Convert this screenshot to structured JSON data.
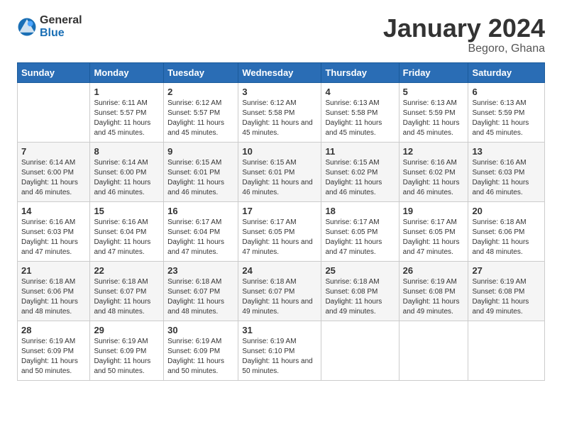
{
  "header": {
    "logo_general": "General",
    "logo_blue": "Blue",
    "title": "January 2024",
    "subtitle": "Begoro, Ghana"
  },
  "calendar": {
    "columns": [
      "Sunday",
      "Monday",
      "Tuesday",
      "Wednesday",
      "Thursday",
      "Friday",
      "Saturday"
    ],
    "weeks": [
      [
        {
          "day": "",
          "sunrise": "",
          "sunset": "",
          "daylight": ""
        },
        {
          "day": "1",
          "sunrise": "6:11 AM",
          "sunset": "5:57 PM",
          "daylight": "11 hours and 45 minutes."
        },
        {
          "day": "2",
          "sunrise": "6:12 AM",
          "sunset": "5:57 PM",
          "daylight": "11 hours and 45 minutes."
        },
        {
          "day": "3",
          "sunrise": "6:12 AM",
          "sunset": "5:58 PM",
          "daylight": "11 hours and 45 minutes."
        },
        {
          "day": "4",
          "sunrise": "6:13 AM",
          "sunset": "5:58 PM",
          "daylight": "11 hours and 45 minutes."
        },
        {
          "day": "5",
          "sunrise": "6:13 AM",
          "sunset": "5:59 PM",
          "daylight": "11 hours and 45 minutes."
        },
        {
          "day": "6",
          "sunrise": "6:13 AM",
          "sunset": "5:59 PM",
          "daylight": "11 hours and 45 minutes."
        }
      ],
      [
        {
          "day": "7",
          "sunrise": "6:14 AM",
          "sunset": "6:00 PM",
          "daylight": "11 hours and 46 minutes."
        },
        {
          "day": "8",
          "sunrise": "6:14 AM",
          "sunset": "6:00 PM",
          "daylight": "11 hours and 46 minutes."
        },
        {
          "day": "9",
          "sunrise": "6:15 AM",
          "sunset": "6:01 PM",
          "daylight": "11 hours and 46 minutes."
        },
        {
          "day": "10",
          "sunrise": "6:15 AM",
          "sunset": "6:01 PM",
          "daylight": "11 hours and 46 minutes."
        },
        {
          "day": "11",
          "sunrise": "6:15 AM",
          "sunset": "6:02 PM",
          "daylight": "11 hours and 46 minutes."
        },
        {
          "day": "12",
          "sunrise": "6:16 AM",
          "sunset": "6:02 PM",
          "daylight": "11 hours and 46 minutes."
        },
        {
          "day": "13",
          "sunrise": "6:16 AM",
          "sunset": "6:03 PM",
          "daylight": "11 hours and 46 minutes."
        }
      ],
      [
        {
          "day": "14",
          "sunrise": "6:16 AM",
          "sunset": "6:03 PM",
          "daylight": "11 hours and 47 minutes."
        },
        {
          "day": "15",
          "sunrise": "6:16 AM",
          "sunset": "6:04 PM",
          "daylight": "11 hours and 47 minutes."
        },
        {
          "day": "16",
          "sunrise": "6:17 AM",
          "sunset": "6:04 PM",
          "daylight": "11 hours and 47 minutes."
        },
        {
          "day": "17",
          "sunrise": "6:17 AM",
          "sunset": "6:05 PM",
          "daylight": "11 hours and 47 minutes."
        },
        {
          "day": "18",
          "sunrise": "6:17 AM",
          "sunset": "6:05 PM",
          "daylight": "11 hours and 47 minutes."
        },
        {
          "day": "19",
          "sunrise": "6:17 AM",
          "sunset": "6:05 PM",
          "daylight": "11 hours and 47 minutes."
        },
        {
          "day": "20",
          "sunrise": "6:18 AM",
          "sunset": "6:06 PM",
          "daylight": "11 hours and 48 minutes."
        }
      ],
      [
        {
          "day": "21",
          "sunrise": "6:18 AM",
          "sunset": "6:06 PM",
          "daylight": "11 hours and 48 minutes."
        },
        {
          "day": "22",
          "sunrise": "6:18 AM",
          "sunset": "6:07 PM",
          "daylight": "11 hours and 48 minutes."
        },
        {
          "day": "23",
          "sunrise": "6:18 AM",
          "sunset": "6:07 PM",
          "daylight": "11 hours and 48 minutes."
        },
        {
          "day": "24",
          "sunrise": "6:18 AM",
          "sunset": "6:07 PM",
          "daylight": "11 hours and 49 minutes."
        },
        {
          "day": "25",
          "sunrise": "6:18 AM",
          "sunset": "6:08 PM",
          "daylight": "11 hours and 49 minutes."
        },
        {
          "day": "26",
          "sunrise": "6:19 AM",
          "sunset": "6:08 PM",
          "daylight": "11 hours and 49 minutes."
        },
        {
          "day": "27",
          "sunrise": "6:19 AM",
          "sunset": "6:08 PM",
          "daylight": "11 hours and 49 minutes."
        }
      ],
      [
        {
          "day": "28",
          "sunrise": "6:19 AM",
          "sunset": "6:09 PM",
          "daylight": "11 hours and 50 minutes."
        },
        {
          "day": "29",
          "sunrise": "6:19 AM",
          "sunset": "6:09 PM",
          "daylight": "11 hours and 50 minutes."
        },
        {
          "day": "30",
          "sunrise": "6:19 AM",
          "sunset": "6:09 PM",
          "daylight": "11 hours and 50 minutes."
        },
        {
          "day": "31",
          "sunrise": "6:19 AM",
          "sunset": "6:10 PM",
          "daylight": "11 hours and 50 minutes."
        },
        {
          "day": "",
          "sunrise": "",
          "sunset": "",
          "daylight": ""
        },
        {
          "day": "",
          "sunrise": "",
          "sunset": "",
          "daylight": ""
        },
        {
          "day": "",
          "sunrise": "",
          "sunset": "",
          "daylight": ""
        }
      ]
    ]
  }
}
